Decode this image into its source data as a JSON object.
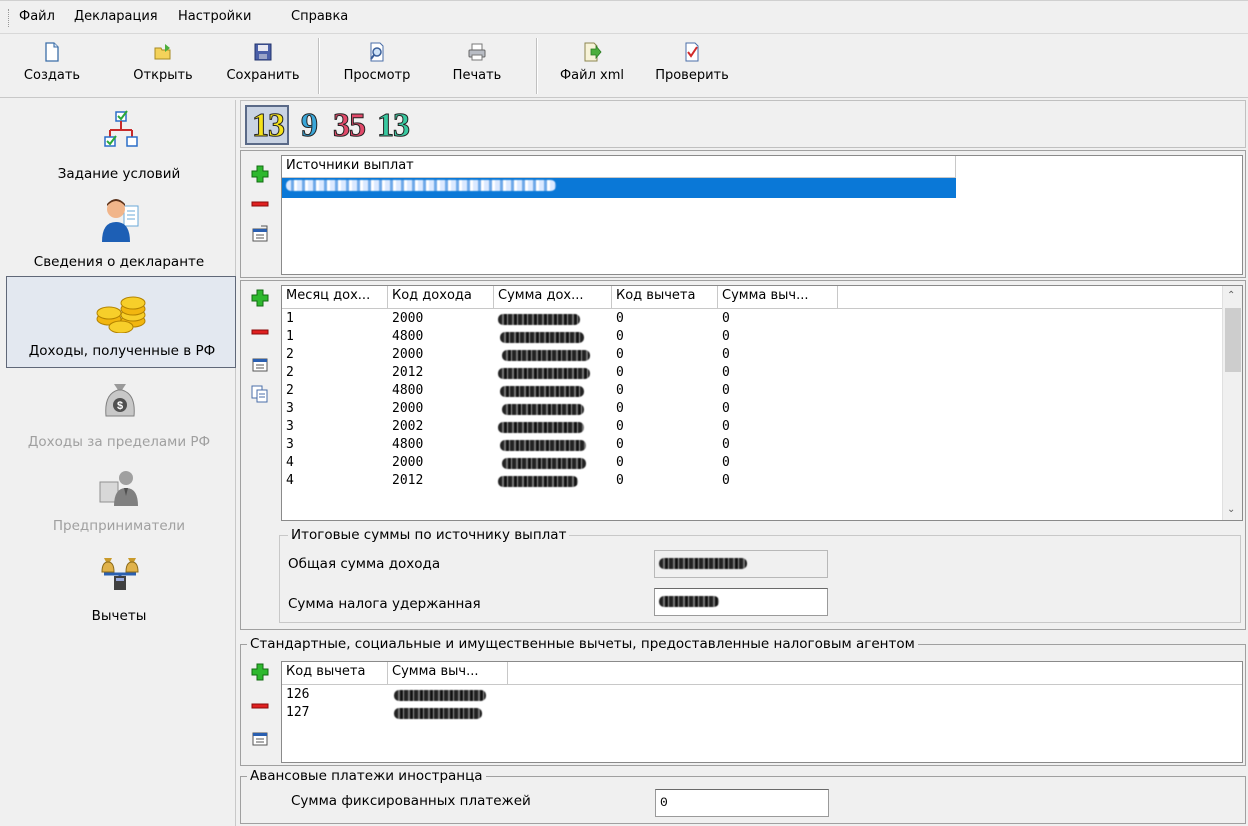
{
  "menu": {
    "items": [
      "Файл",
      "Декларация",
      "Настройки",
      "Справка"
    ]
  },
  "toolbar": {
    "create": "Создать",
    "open": "Открыть",
    "save": "Сохранить",
    "preview": "Просмотр",
    "print": "Печать",
    "xml": "Файл xml",
    "check": "Проверить"
  },
  "sidebar": {
    "items": [
      {
        "label": "Задание условий",
        "icon": "tree-icon",
        "state": "normal"
      },
      {
        "label": "Сведения о декларанте",
        "icon": "person-icon",
        "state": "normal"
      },
      {
        "label": "Доходы, полученные в РФ",
        "icon": "coins-icon",
        "state": "active"
      },
      {
        "label": "Доходы за пределами РФ",
        "icon": "money-bag-icon",
        "state": "disabled"
      },
      {
        "label": "Предприниматели",
        "icon": "businessman-icon",
        "state": "disabled"
      },
      {
        "label": "Вычеты",
        "icon": "scales-icon",
        "state": "normal"
      }
    ]
  },
  "rates": {
    "values": [
      "13",
      "9",
      "35",
      "13"
    ],
    "colors": [
      "#f5e21a",
      "#3aa6d8",
      "#e24a6a",
      "#39c9a0"
    ]
  },
  "sources": {
    "header": "Источники выплат",
    "selected_color": "#0a78d7"
  },
  "income": {
    "columns": [
      "Месяц дох...",
      "Код дохода",
      "Сумма дох...",
      "Код вычета",
      "Сумма выч..."
    ],
    "rows": [
      {
        "month": "1",
        "code": "2000",
        "deduction_code": "0",
        "deduction_sum": "0"
      },
      {
        "month": "1",
        "code": "4800",
        "deduction_code": "0",
        "deduction_sum": "0"
      },
      {
        "month": "2",
        "code": "2000",
        "deduction_code": "0",
        "deduction_sum": "0"
      },
      {
        "month": "2",
        "code": "2012",
        "deduction_code": "0",
        "deduction_sum": "0"
      },
      {
        "month": "2",
        "code": "4800",
        "deduction_code": "0",
        "deduction_sum": "0"
      },
      {
        "month": "3",
        "code": "2000",
        "deduction_code": "0",
        "deduction_sum": "0"
      },
      {
        "month": "3",
        "code": "2002",
        "deduction_code": "0",
        "deduction_sum": "0"
      },
      {
        "month": "3",
        "code": "4800",
        "deduction_code": "0",
        "deduction_sum": "0"
      },
      {
        "month": "4",
        "code": "2000",
        "deduction_code": "0",
        "deduction_sum": "0"
      },
      {
        "month": "4",
        "code": "2012",
        "deduction_code": "0",
        "deduction_sum": "0"
      }
    ]
  },
  "totals": {
    "legend": "Итоговые суммы по источнику выплат",
    "total_income_label": "Общая сумма дохода",
    "tax_withheld_label": "Сумма налога удержанная"
  },
  "deductions": {
    "legend": "Стандартные, социальные и имущественные вычеты, предоставленные налоговым агентом",
    "columns": [
      "Код вычета",
      "Сумма выч..."
    ],
    "rows": [
      {
        "code": "126"
      },
      {
        "code": "127"
      }
    ]
  },
  "advance": {
    "legend": "Авансовые платежи иностранца",
    "fixed_label": "Сумма фиксированных платежей",
    "fixed_value": "0"
  }
}
